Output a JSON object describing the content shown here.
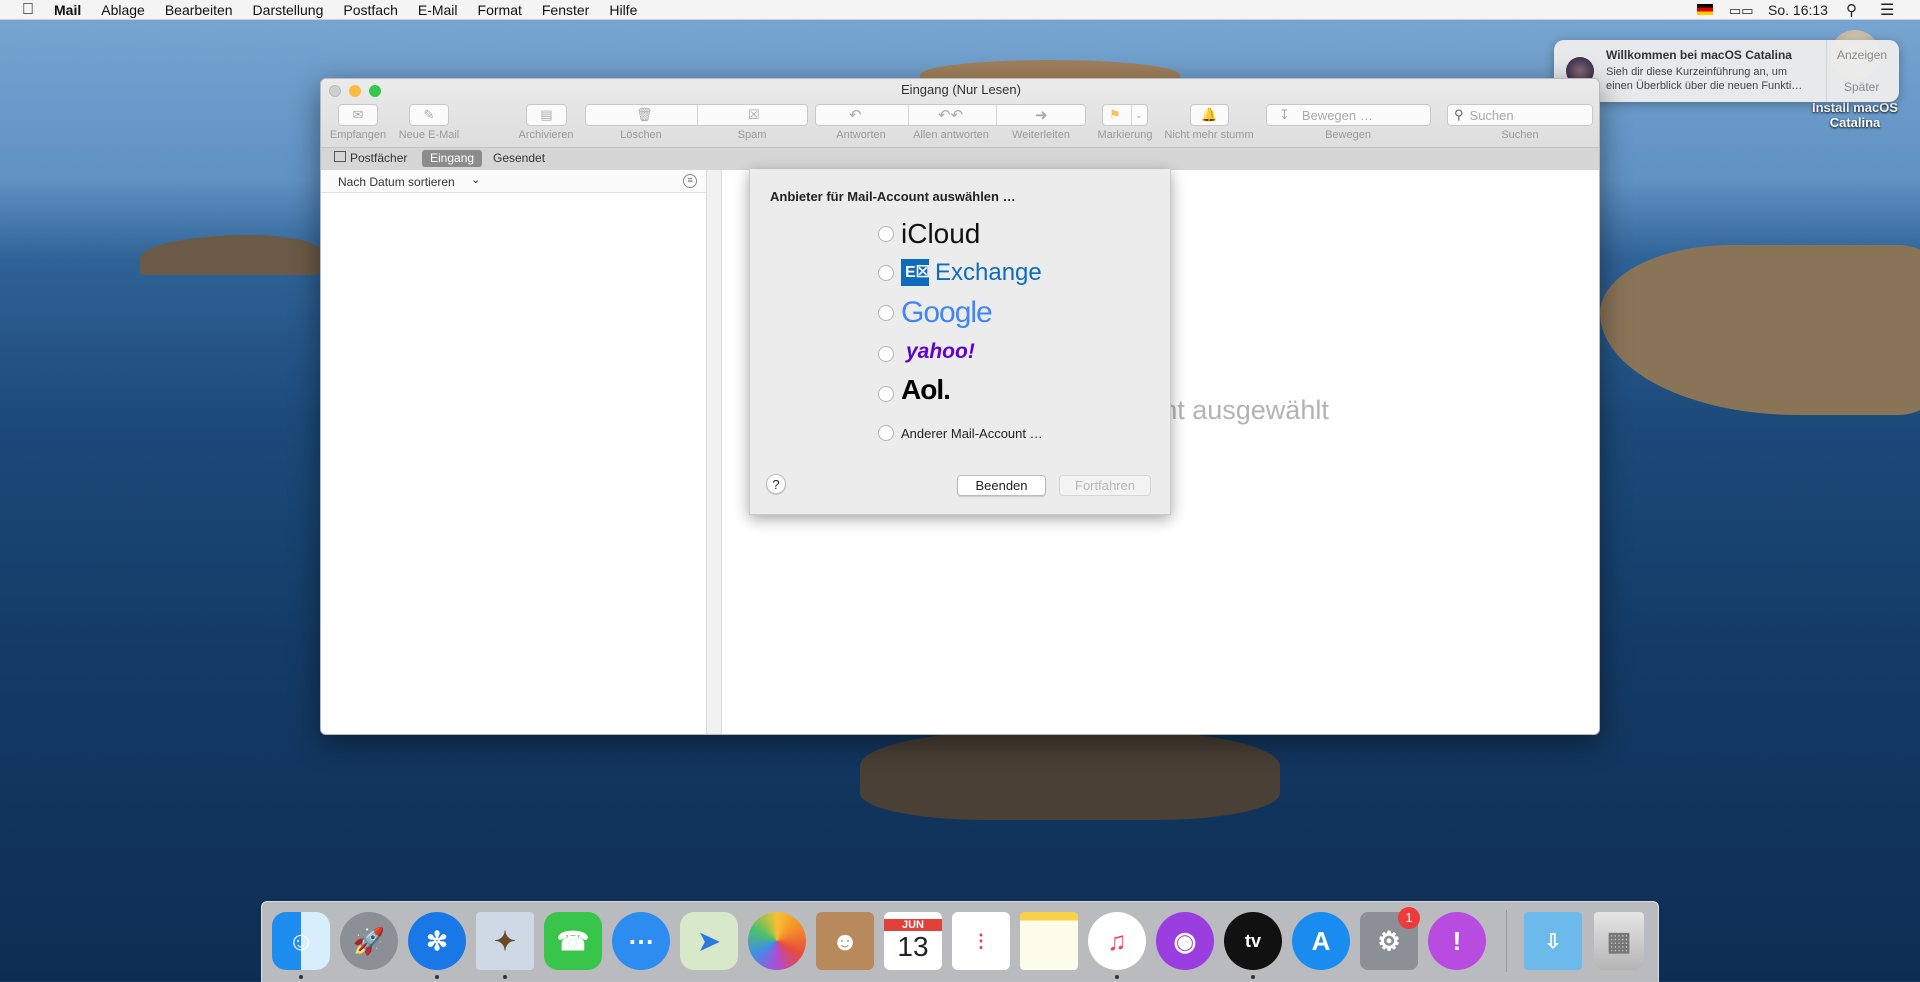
{
  "menubar": {
    "app": "Mail",
    "items": [
      "Ablage",
      "Bearbeiten",
      "Darstellung",
      "Postfach",
      "E-Mail",
      "Format",
      "Fenster",
      "Hilfe"
    ],
    "clock": "So. 16:13"
  },
  "desktop": {
    "icon_label": "Install macOS Catalina"
  },
  "notification": {
    "title": "Willkommen bei macOS Catalina",
    "body1": "Sieh dir diese Kurzeinführung an, um",
    "body2": "einen Überblick über die neuen Funkti…",
    "action1": "Anzeigen",
    "action2": "Später"
  },
  "window": {
    "title": "Eingang (Nur Lesen)",
    "toolbar": {
      "empfangen": "Empfangen",
      "neue": "Neue E-Mail",
      "archivieren": "Archivieren",
      "loeschen": "Löschen",
      "spam": "Spam",
      "antworten": "Antworten",
      "allen": "Allen antworten",
      "weiterleiten": "Weiterleiten",
      "markierung": "Markierung",
      "stumm": "Nicht mehr stumm",
      "bewegen_placeholder": "Bewegen …",
      "bewegen": "Bewegen",
      "suchen_placeholder": "Suchen",
      "suchen": "Suchen"
    },
    "tabs": {
      "postfaecher": "Postfächer",
      "eingang": "Eingang",
      "gesendet": "Gesendet"
    },
    "sort": "Nach Datum sortieren",
    "empty": "Keine Nachricht ausgewählt"
  },
  "sheet": {
    "title": "Anbieter für Mail-Account auswählen …",
    "providers": [
      "iCloud",
      "Exchange",
      "Google",
      "yahoo!",
      "Aol.",
      "Anderer Mail-Account …"
    ],
    "help": "?",
    "cancel": "Beenden",
    "continue": "Fortfahren"
  },
  "dock": {
    "calendar_month": "JUN",
    "calendar_day": "13",
    "badge": "1",
    "tv": "tv",
    "items": [
      "finder",
      "launchpad",
      "safari",
      "mail",
      "facetime",
      "messages",
      "maps",
      "photos",
      "contacts",
      "calendar",
      "reminders",
      "notes",
      "music",
      "podcasts",
      "tv",
      "app-store",
      "system-preferences",
      "feedback-assistant",
      "downloads",
      "trash"
    ]
  },
  "colors": {
    "accent": "#0a84ff",
    "exchange": "#0f6cbd",
    "yahoo": "#6001d2"
  }
}
